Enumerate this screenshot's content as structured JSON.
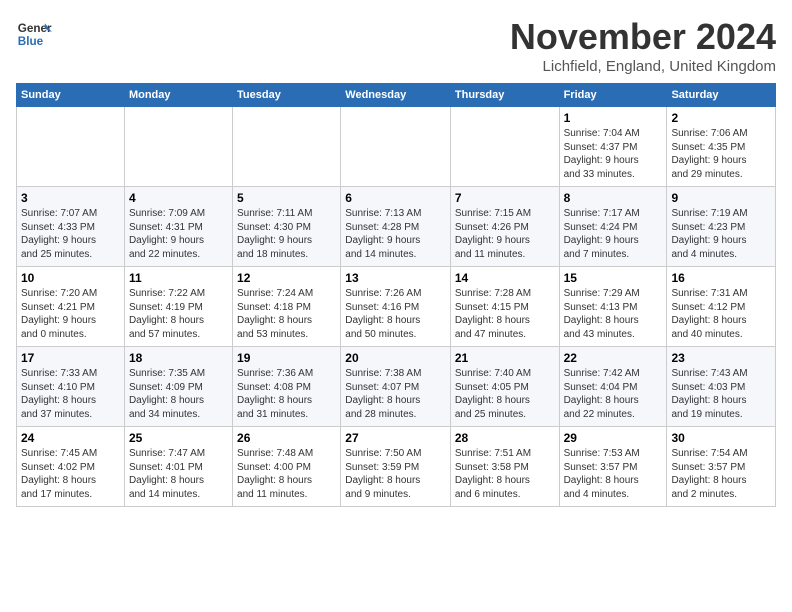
{
  "header": {
    "logo_line1": "General",
    "logo_line2": "Blue",
    "month": "November 2024",
    "location": "Lichfield, England, United Kingdom"
  },
  "weekdays": [
    "Sunday",
    "Monday",
    "Tuesday",
    "Wednesday",
    "Thursday",
    "Friday",
    "Saturday"
  ],
  "weeks": [
    [
      {
        "day": "",
        "info": ""
      },
      {
        "day": "",
        "info": ""
      },
      {
        "day": "",
        "info": ""
      },
      {
        "day": "",
        "info": ""
      },
      {
        "day": "",
        "info": ""
      },
      {
        "day": "1",
        "info": "Sunrise: 7:04 AM\nSunset: 4:37 PM\nDaylight: 9 hours\nand 33 minutes."
      },
      {
        "day": "2",
        "info": "Sunrise: 7:06 AM\nSunset: 4:35 PM\nDaylight: 9 hours\nand 29 minutes."
      }
    ],
    [
      {
        "day": "3",
        "info": "Sunrise: 7:07 AM\nSunset: 4:33 PM\nDaylight: 9 hours\nand 25 minutes."
      },
      {
        "day": "4",
        "info": "Sunrise: 7:09 AM\nSunset: 4:31 PM\nDaylight: 9 hours\nand 22 minutes."
      },
      {
        "day": "5",
        "info": "Sunrise: 7:11 AM\nSunset: 4:30 PM\nDaylight: 9 hours\nand 18 minutes."
      },
      {
        "day": "6",
        "info": "Sunrise: 7:13 AM\nSunset: 4:28 PM\nDaylight: 9 hours\nand 14 minutes."
      },
      {
        "day": "7",
        "info": "Sunrise: 7:15 AM\nSunset: 4:26 PM\nDaylight: 9 hours\nand 11 minutes."
      },
      {
        "day": "8",
        "info": "Sunrise: 7:17 AM\nSunset: 4:24 PM\nDaylight: 9 hours\nand 7 minutes."
      },
      {
        "day": "9",
        "info": "Sunrise: 7:19 AM\nSunset: 4:23 PM\nDaylight: 9 hours\nand 4 minutes."
      }
    ],
    [
      {
        "day": "10",
        "info": "Sunrise: 7:20 AM\nSunset: 4:21 PM\nDaylight: 9 hours\nand 0 minutes."
      },
      {
        "day": "11",
        "info": "Sunrise: 7:22 AM\nSunset: 4:19 PM\nDaylight: 8 hours\nand 57 minutes."
      },
      {
        "day": "12",
        "info": "Sunrise: 7:24 AM\nSunset: 4:18 PM\nDaylight: 8 hours\nand 53 minutes."
      },
      {
        "day": "13",
        "info": "Sunrise: 7:26 AM\nSunset: 4:16 PM\nDaylight: 8 hours\nand 50 minutes."
      },
      {
        "day": "14",
        "info": "Sunrise: 7:28 AM\nSunset: 4:15 PM\nDaylight: 8 hours\nand 47 minutes."
      },
      {
        "day": "15",
        "info": "Sunrise: 7:29 AM\nSunset: 4:13 PM\nDaylight: 8 hours\nand 43 minutes."
      },
      {
        "day": "16",
        "info": "Sunrise: 7:31 AM\nSunset: 4:12 PM\nDaylight: 8 hours\nand 40 minutes."
      }
    ],
    [
      {
        "day": "17",
        "info": "Sunrise: 7:33 AM\nSunset: 4:10 PM\nDaylight: 8 hours\nand 37 minutes."
      },
      {
        "day": "18",
        "info": "Sunrise: 7:35 AM\nSunset: 4:09 PM\nDaylight: 8 hours\nand 34 minutes."
      },
      {
        "day": "19",
        "info": "Sunrise: 7:36 AM\nSunset: 4:08 PM\nDaylight: 8 hours\nand 31 minutes."
      },
      {
        "day": "20",
        "info": "Sunrise: 7:38 AM\nSunset: 4:07 PM\nDaylight: 8 hours\nand 28 minutes."
      },
      {
        "day": "21",
        "info": "Sunrise: 7:40 AM\nSunset: 4:05 PM\nDaylight: 8 hours\nand 25 minutes."
      },
      {
        "day": "22",
        "info": "Sunrise: 7:42 AM\nSunset: 4:04 PM\nDaylight: 8 hours\nand 22 minutes."
      },
      {
        "day": "23",
        "info": "Sunrise: 7:43 AM\nSunset: 4:03 PM\nDaylight: 8 hours\nand 19 minutes."
      }
    ],
    [
      {
        "day": "24",
        "info": "Sunrise: 7:45 AM\nSunset: 4:02 PM\nDaylight: 8 hours\nand 17 minutes."
      },
      {
        "day": "25",
        "info": "Sunrise: 7:47 AM\nSunset: 4:01 PM\nDaylight: 8 hours\nand 14 minutes."
      },
      {
        "day": "26",
        "info": "Sunrise: 7:48 AM\nSunset: 4:00 PM\nDaylight: 8 hours\nand 11 minutes."
      },
      {
        "day": "27",
        "info": "Sunrise: 7:50 AM\nSunset: 3:59 PM\nDaylight: 8 hours\nand 9 minutes."
      },
      {
        "day": "28",
        "info": "Sunrise: 7:51 AM\nSunset: 3:58 PM\nDaylight: 8 hours\nand 6 minutes."
      },
      {
        "day": "29",
        "info": "Sunrise: 7:53 AM\nSunset: 3:57 PM\nDaylight: 8 hours\nand 4 minutes."
      },
      {
        "day": "30",
        "info": "Sunrise: 7:54 AM\nSunset: 3:57 PM\nDaylight: 8 hours\nand 2 minutes."
      }
    ]
  ]
}
